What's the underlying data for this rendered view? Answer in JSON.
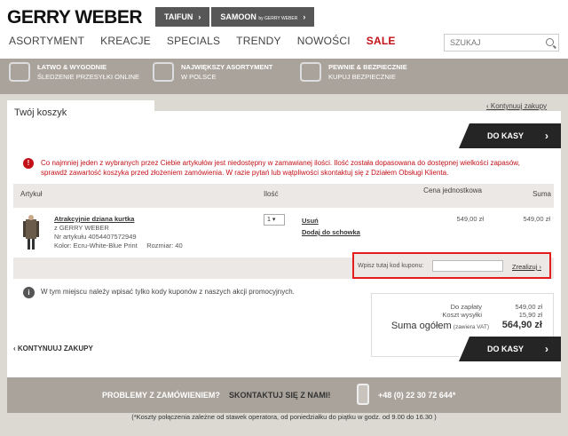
{
  "header": {
    "logo": "GERRY WEBER",
    "brand_tabs": [
      {
        "label": "TAIFUN",
        "by": ""
      },
      {
        "label": "SAMOON",
        "by": "by GERRY WEBER"
      }
    ],
    "nav": [
      "ASORTYMENT",
      "KREACJE",
      "SPECIALS",
      "TRENDY",
      "NOWOŚCI",
      "SALE"
    ],
    "search_placeholder": "SZUKAJ"
  },
  "benefits": [
    {
      "title": "ŁATWO & WYGODNIE",
      "sub": "ŚLEDZENIE PRZESYŁKI ONLINE"
    },
    {
      "title": "NAJWIĘKSZY ASORTYMENT",
      "sub": "W POLSCE"
    },
    {
      "title": "PEWNIE & BEZPIECZNIE",
      "sub": "KUPUJ BEZPIECZNIE"
    }
  ],
  "cart": {
    "title": "Twój koszyk",
    "continue_top": "Kontynuuj zakupy",
    "checkout_label": "DO KASY",
    "alert": "Co najmniej jeden z wybranych przez Ciebie artykułów jest niedostępny w zamawianej ilości. Ilość została dopasowana do dostępnej wielkości zapasów, sprawdź zawartość koszyka przed złożeniem zamówienia. W razie pytań lub wątpliwości skontaktuj się z Działem Obsługi Klienta.",
    "table_headers": {
      "article": "Artykuł",
      "qty": "Ilość",
      "unit_price": "Cena jednostkowa",
      "sum": "Suma"
    },
    "item": {
      "name": "Atrakcyjnie dziana kurtka",
      "brand": "z GERRY WEBER",
      "article_no": "Nr artykułu 4054407572949",
      "color": "Kolor: Ecru-White-Blue Print",
      "size": "Rozmiar: 40",
      "qty": "1",
      "remove": "Usuń",
      "save": "Dodaj do schowka",
      "unit_price": "549,00 zł",
      "sum": "549,00 zł"
    },
    "coupon": {
      "label": "Wpisz tutaj kod kuponu:",
      "apply": "Zrealizuj"
    },
    "coupon_info": "W tym miejscu należy wpisać tylko kody kuponów z naszych akcji promocyjnych.",
    "summary": {
      "to_pay_label": "Do zapłaty",
      "to_pay": "549,00 zł",
      "shipping_label": "Koszt wysyłki",
      "shipping": "15,90 zł",
      "total_label": "Suma ogółem",
      "vat_note": "(zawiera VAT)",
      "total": "564,90 zł"
    },
    "continue_bottom": "KONTYNUUJ ZAKUPY"
  },
  "help": {
    "problems": "PROBLEMY Z ZAMÓWIENIEM?",
    "contact": "SKONTAKTUJ SIĘ Z NAMI!",
    "phone": "+48 (0) 22 30 72 644*"
  },
  "footnote": "(*Koszty połączenia zależne od stawek operatora, od poniedziałku do piątku w godz. od 9.00 do 16.30 )"
}
